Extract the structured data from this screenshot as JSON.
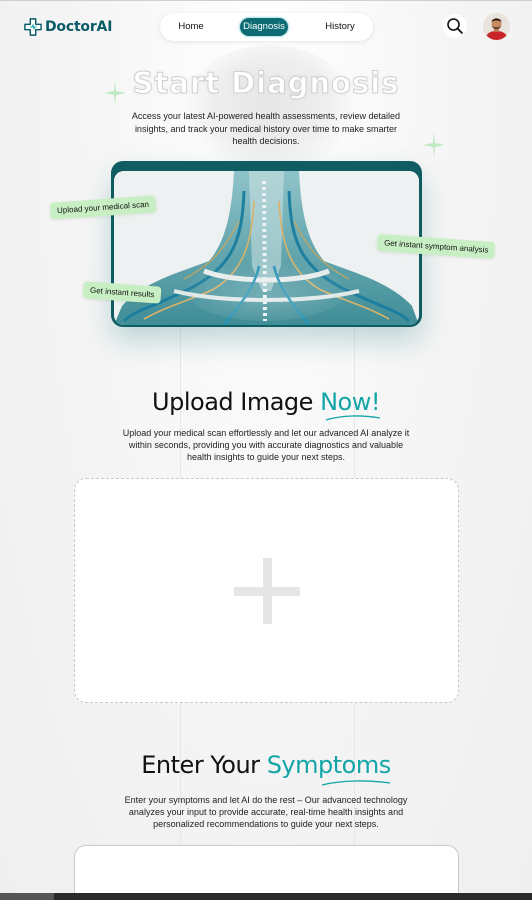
{
  "header": {
    "logo_text": "DoctorAI",
    "nav": [
      {
        "label": "Home",
        "active": false
      },
      {
        "label": "Diagnosis",
        "active": true
      },
      {
        "label": "History",
        "active": false
      }
    ],
    "search_icon": "search-icon",
    "avatar_icon": "user-avatar"
  },
  "hero": {
    "title": "Start Diagnosis",
    "subtitle": "Access your latest AI-powered health assessments, review detailed insights, and track your medical history over time to make smarter health decisions.",
    "tags": {
      "upload": "Upload your medical scan",
      "symptom": "Get instant symptom analysis",
      "results": "Get instant results"
    }
  },
  "upload": {
    "title_main": "Upload Image ",
    "title_accent": "Now!",
    "subtitle": "Upload your medical scan effortlessly and let our advanced AI analyze it within seconds, providing you with accurate diagnostics and valuable health insights to guide your next steps.",
    "dropzone_icon": "plus-icon"
  },
  "symptoms": {
    "title_main": "Enter Your ",
    "title_accent": "Symptoms",
    "subtitle": "Enter your symptoms and let AI do the rest – Our advanced technology analyzes your input to provide accurate, real-time health insights and personalized recommendations to guide your next steps."
  },
  "colors": {
    "brand": "#0a5a66",
    "accent": "#14a5a8",
    "tag_bg": "#c8efc3",
    "nav_active": "#0d6b74"
  }
}
